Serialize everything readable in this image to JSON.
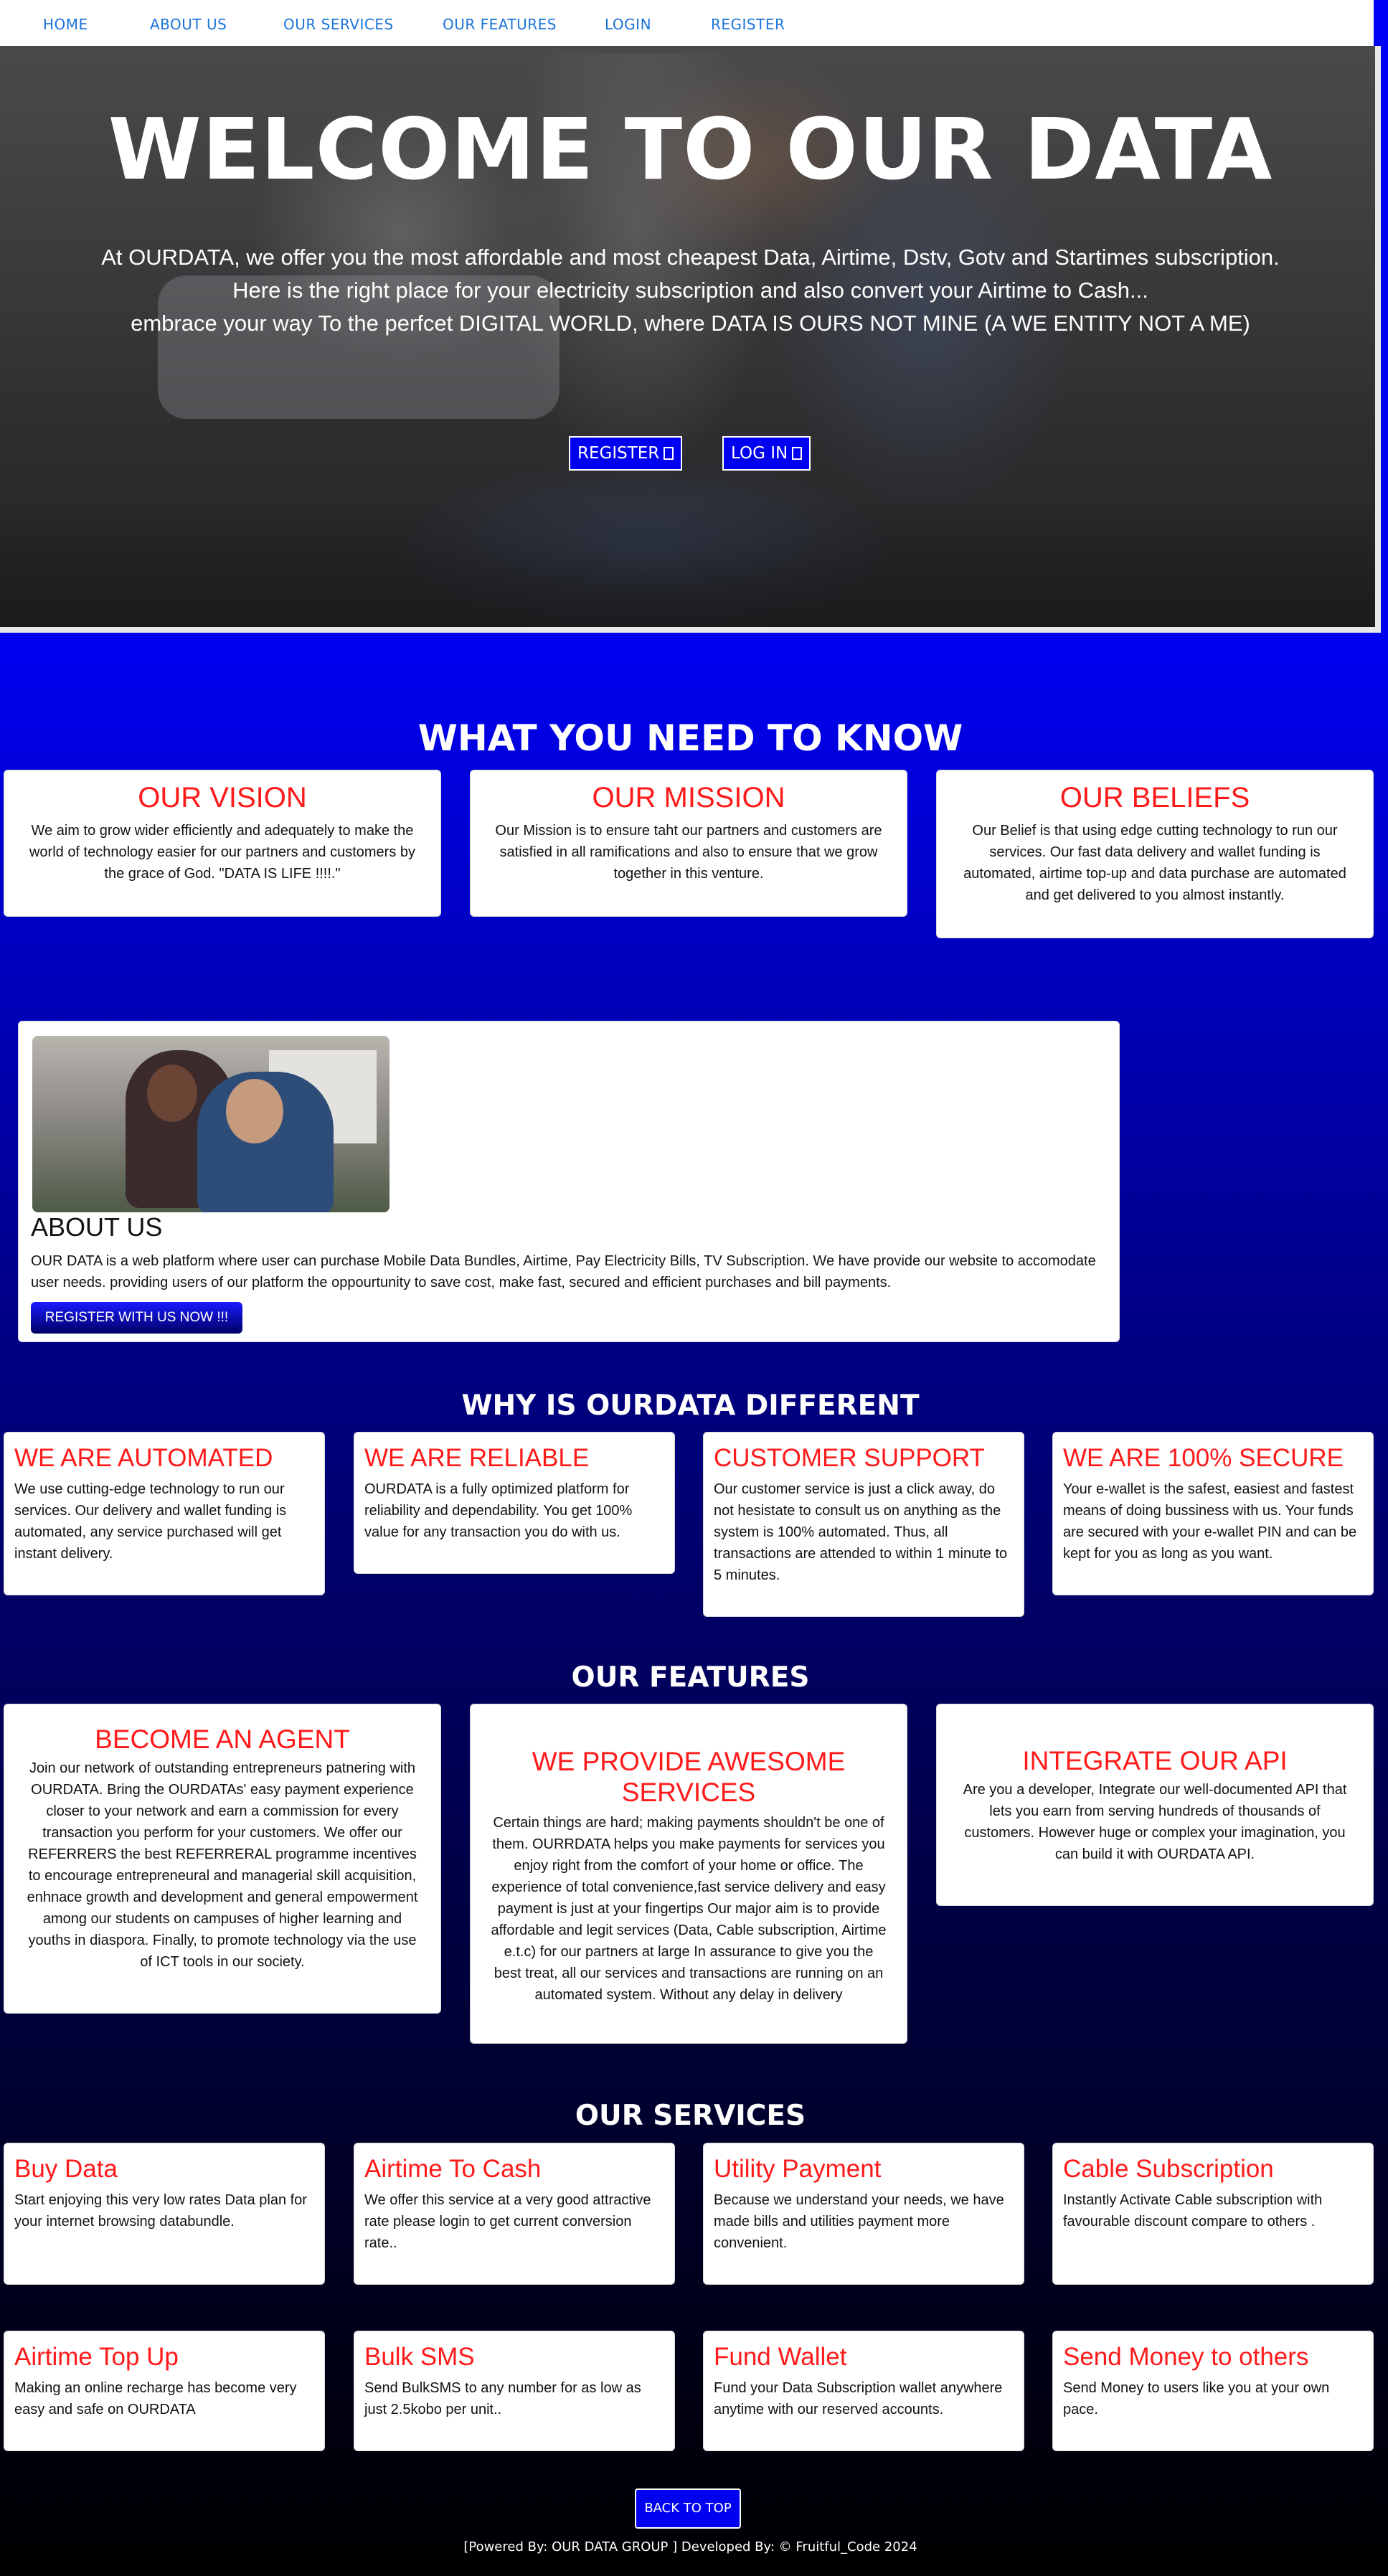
{
  "nav": {
    "items": [
      "HOME",
      "ABOUT US",
      "OUR SERVICES",
      "OUR FEATURES",
      "LOGIN",
      "REGISTER"
    ]
  },
  "hero": {
    "title": "WELCOME TO OUR DATA",
    "line1": "At OURDATA, we offer you the most affordable and most cheapest Data, Airtime, Dstv, Gotv and Startimes subscription.",
    "line2": "Here is the right place for your electricity subscription and also convert your Airtime to Cash...",
    "line3": "embrace your way To the perfcet DIGITAL WORLD, where DATA IS OURS NOT MINE (A WE ENTITY NOT A ME)",
    "register_label": "REGISTER",
    "login_label": "LOG IN"
  },
  "know": {
    "heading": "WHAT YOU NEED TO KNOW",
    "cards": [
      {
        "title": "OUR VISION",
        "body": "We aim to grow wider efficiently and adequately to make the world of technology easier for our partners and customers by the grace of God. \"DATA IS LIFE !!!!.\""
      },
      {
        "title": "OUR MISSION",
        "body": "Our Mission is to ensure taht our partners and customers are satisfied in all ramifications and also to ensure that we grow together in this venture."
      },
      {
        "title": "OUR BELIEFS",
        "body": "Our Belief is that using edge cutting technology to run our services. Our fast data delivery and wallet funding is automated, airtime top-up and data purchase are automated and get delivered to you almost instantly."
      }
    ]
  },
  "about": {
    "title": "ABOUT US",
    "text": "OUR DATA is a web platform where user can purchase Mobile Data Bundles, Airtime, Pay Electricity Bills, TV Subscription. We have provide our website to accomodate user needs. providing users of our platform the oppourtunity to save cost, make fast, secured and efficient purchases and bill payments.",
    "button": "REGISTER WITH US NOW !!!"
  },
  "different": {
    "heading": "WHY IS OURDATA DIFFERENT",
    "cards": [
      {
        "title": "WE ARE AUTOMATED",
        "body": "We use cutting-edge technology to run our services. Our delivery and wallet funding is automated, any service purchased will get instant delivery."
      },
      {
        "title": "WE ARE RELIABLE",
        "body": "OURDATA is a fully optimized platform for reliability and dependability. You get 100% value for any transaction you do with us."
      },
      {
        "title": "CUSTOMER SUPPORT",
        "body": "Our customer service is just a click away, do not hesistate to consult us on anything as the system is 100% automated. Thus, all transactions are attended to within 1 minute to 5 minutes."
      },
      {
        "title": "WE ARE 100% SECURE",
        "body": "Your e-wallet is the safest, easiest and fastest means of doing bussiness with us. Your funds are secured with your e-wallet PIN and can be kept for you as long as you want."
      }
    ]
  },
  "features": {
    "heading": "OUR FEATURES",
    "cards": [
      {
        "title": "BECOME AN AGENT",
        "body": "Join our network of outstanding entrepreneurs patnering with OURDATA. Bring the OURDATAs' easy payment experience closer to your network and earn a commission for every transaction you perform for your customers. We offer our REFERRERS the best REFERRERAL programme incentives to encourage entrepreneural and managerial skill acquisition, enhnace growth and development and general empowerment among our students on campuses of higher learning and youths in diaspora. Finally, to promote technology via the use of ICT tools in our society."
      },
      {
        "title": "WE PROVIDE AWESOME SERVICES",
        "body": "Certain things are hard; making payments shouldn't be one of them. OURRDATA helps you make payments for services you enjoy right from the comfort of your home or office. The experience of total convenience,fast service delivery and easy payment is just at your fingertips Our major aim is to provide affordable and legit services (Data, Cable subscription, Airtime e.t.c) for our partners at large In assurance to give you the best treat, all our services and transactions are running on an automated system. Without any delay in delivery"
      },
      {
        "title": "INTEGRATE OUR API",
        "body": "Are you a developer, Integrate our well-documented API that lets you earn from serving hundreds of thousands of customers. However huge or complex your imagination, you can build it with OURDATA API."
      }
    ]
  },
  "services": {
    "heading": "OUR SERVICES",
    "cards": [
      {
        "title": "Buy Data",
        "body": "Start enjoying this very low rates Data plan for your internet browsing databundle."
      },
      {
        "title": "Airtime To Cash",
        "body": "We offer this service at a very good attractive rate please login to get current conversion rate.."
      },
      {
        "title": "Utility Payment",
        "body": "Because we understand your needs, we have made bills and utilities payment more convenient."
      },
      {
        "title": "Cable Subscription",
        "body": "Instantly Activate Cable subscription with favourable discount compare to others ."
      },
      {
        "title": "Airtime Top Up",
        "body": "Making an online recharge has become very easy and safe on OURDATA"
      },
      {
        "title": "Bulk SMS",
        "body": "Send BulkSMS to any number for as low as just 2.5kobo per unit.."
      },
      {
        "title": "Fund Wallet",
        "body": "Fund your Data Subscription wallet anywhere anytime with our reserved accounts."
      },
      {
        "title": "Send Money to others",
        "body": "Send Money to users like you at your own pace."
      }
    ]
  },
  "back_to_top": "BACK TO TOP",
  "footer": "[Powered By: OUR DATA GROUP ] Developed By: © Fruitful_Code 2024"
}
